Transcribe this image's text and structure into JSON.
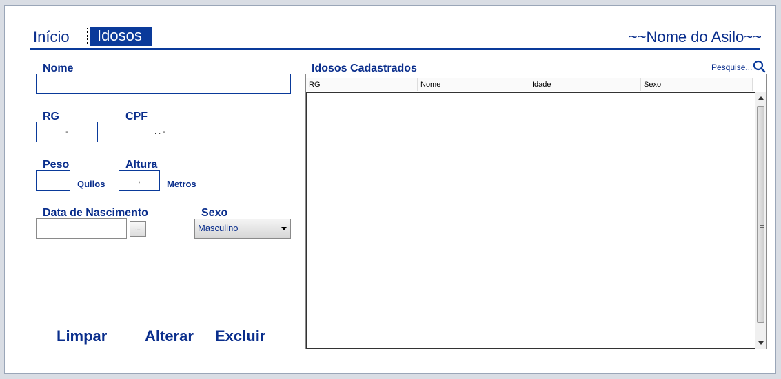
{
  "header": {
    "tabs": [
      {
        "label": "Início"
      },
      {
        "label": "Idosos"
      }
    ],
    "asylum_name": "~~Nome do Asilo~~"
  },
  "form": {
    "nome_label": "Nome",
    "nome_value": "",
    "rg_label": "RG",
    "rg_mask": "-",
    "cpf_label": "CPF",
    "cpf_mask": ".  .  -",
    "peso_label": "Peso",
    "peso_value": "",
    "peso_unit": "Quilos",
    "altura_label": "Altura",
    "altura_mask": ",",
    "altura_unit": "Metros",
    "nascimento_label": "Data de Nascimento",
    "nascimento_value": "",
    "date_button": "...",
    "sexo_label": "Sexo",
    "sexo_selected": "Masculino"
  },
  "actions": {
    "limpar": "Limpar",
    "alterar": "Alterar",
    "excluir": "Excluir"
  },
  "list": {
    "title": "Idosos Cadastrados",
    "search_link": "Pesquise...",
    "columns": [
      "RG",
      "Nome",
      "Idade",
      "Sexo"
    ],
    "rows": []
  },
  "icons": {
    "search": "search-icon"
  },
  "colors": {
    "accent": "#0a3a9a",
    "text": "#0a2e8c"
  }
}
